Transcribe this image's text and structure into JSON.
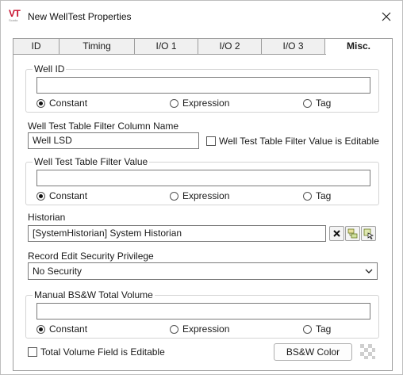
{
  "window": {
    "title": "New WellTest Properties",
    "icon": {
      "name": "vtscada-logo-icon",
      "text": "VT",
      "subtext": "Scada",
      "color": "#c8102e"
    }
  },
  "tabs": [
    {
      "label": "ID",
      "active": false
    },
    {
      "label": "Timing",
      "active": false
    },
    {
      "label": "I/O 1",
      "active": false
    },
    {
      "label": "I/O 2",
      "active": false
    },
    {
      "label": "I/O 3",
      "active": false
    },
    {
      "label": "Misc.",
      "active": true
    }
  ],
  "radio_labels": {
    "constant": "Constant",
    "expression": "Expression",
    "tag": "Tag"
  },
  "well_id": {
    "label": "Well ID",
    "value": "",
    "selected": "constant"
  },
  "filter_column": {
    "label": "Well Test Table Filter Column Name",
    "value": "Well LSD"
  },
  "filter_editable": {
    "label": "Well Test Table Filter Value is Editable",
    "checked": false
  },
  "filter_value": {
    "label": "Well Test Table Filter Value",
    "value": "",
    "selected": "constant"
  },
  "historian": {
    "label": "Historian",
    "value": "[SystemHistorian]    System Historian",
    "buttons": [
      "clear-icon",
      "tag-browse-icon",
      "tag-select-icon"
    ]
  },
  "security": {
    "label": "Record Edit Security Privilege",
    "selected": "No Security"
  },
  "manual_bsw": {
    "label": "Manual BS&W Total Volume",
    "value": "",
    "selected": "constant"
  },
  "total_volume_editable": {
    "label": "Total Volume Field is Editable",
    "checked": false
  },
  "bsw_color_button": {
    "label": "BS&W Color"
  },
  "colors": {
    "accent": "#1a1a1a",
    "border": "#9c9c9c",
    "group_border": "#d4d4d4"
  }
}
